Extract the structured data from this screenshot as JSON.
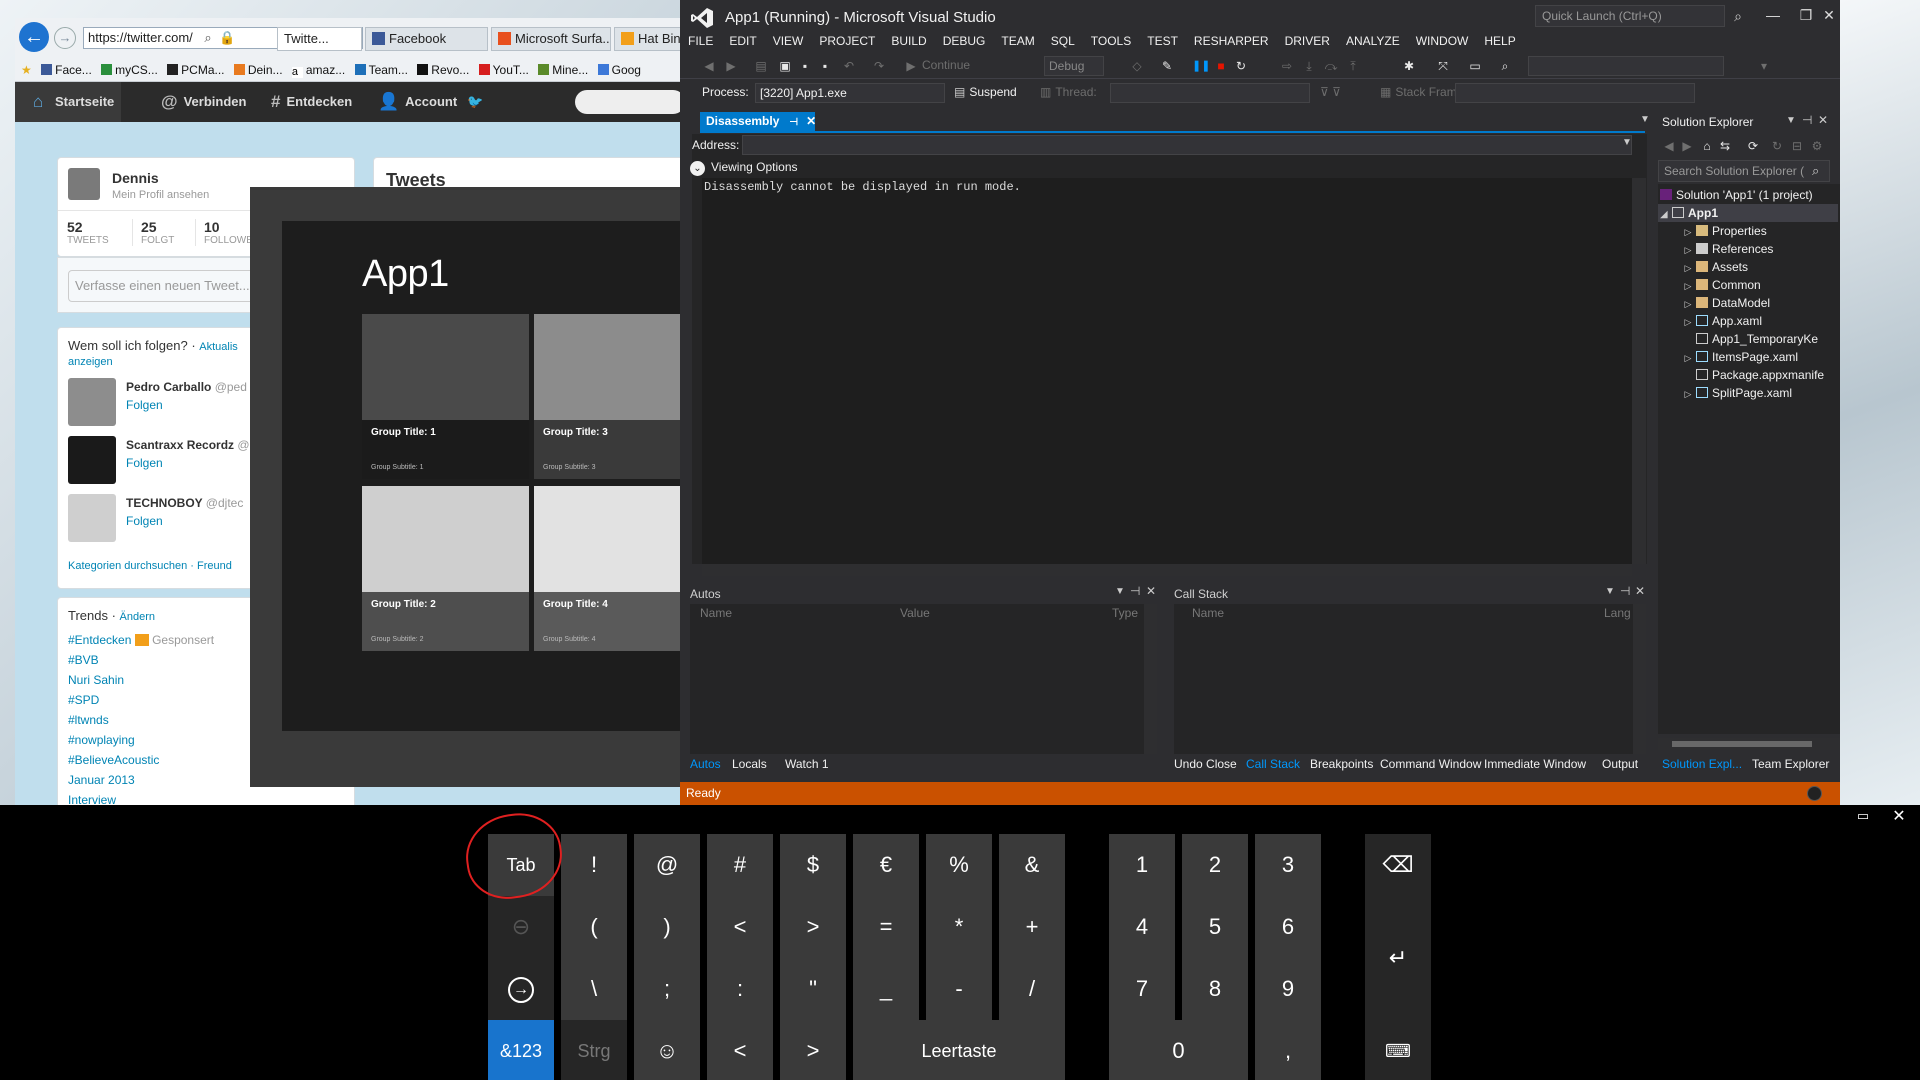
{
  "browser": {
    "address": "https://twitter.com/",
    "tabs": [
      "Twitte...",
      "Facebook",
      "Microsoft Surfa...",
      "Hat Bindin"
    ],
    "favorites": [
      "Face...",
      "myCS...",
      "PCMa...",
      "Dein...",
      "amaz...",
      "Team...",
      "Revo...",
      "YouT...",
      "Mine...",
      "Goog"
    ]
  },
  "twitter": {
    "nav": [
      "Startseite",
      "Verbinden",
      "Entdecken",
      "Account"
    ],
    "profile_name": "Dennis",
    "profile_link": "Mein Profil ansehen",
    "stats": [
      {
        "value": "52",
        "label": "TWEETS"
      },
      {
        "value": "25",
        "label": "FOLGT"
      },
      {
        "value": "10",
        "label": "FOLLOWER"
      }
    ],
    "compose_placeholder": "Verfasse einen neuen Tweet...",
    "tweets_heading": "Tweets",
    "who_to_follow": "Wem soll ich folgen?",
    "refresh": "Aktualis",
    "show_all": "anzeigen",
    "suggestions": [
      {
        "name": "Pedro Carballo",
        "handle": "@ped",
        "action": "Folgen"
      },
      {
        "name": "Scantraxx Recordz",
        "handle": "@",
        "action": "Folgen"
      },
      {
        "name": "TECHNOBOY",
        "handle": "@djtec",
        "action": "Folgen"
      }
    ],
    "browse_categories": "Kategorien durchsuchen",
    "friends_link": "Freund",
    "trends_heading": "Trends",
    "trends_change": "Ändern",
    "trends": [
      "#Entdecken",
      "#BVB",
      "Nuri Sahin",
      "#SPD",
      "#ltwnds",
      "#nowplaying",
      "#BelieveAcoustic",
      "Januar 2013",
      "Interview"
    ],
    "sponsored": "Gesponsert"
  },
  "app1": {
    "title": "App1",
    "tiles": [
      {
        "title": "Group Title: 1",
        "subtitle": "Group Subtitle: 1",
        "color": "#4a4a4a",
        "band": "#1b1b1b"
      },
      {
        "title": "Group Title: 3",
        "subtitle": "Group Subtitle: 3",
        "color": "#8c8c8c",
        "band": "#3a3a3a"
      },
      {
        "title": "Group Title: 2",
        "subtitle": "Group Subtitle: 2",
        "color": "#cfcfcf",
        "band": "#4e4e4e"
      },
      {
        "title": "Group Title: 4",
        "subtitle": "Group Subtitle: 4",
        "color": "#e2e2e2",
        "band": "#5a5a5a"
      }
    ]
  },
  "vs": {
    "title": "App1 (Running) - Microsoft Visual Studio",
    "quick_launch": "Quick Launch (Ctrl+Q)",
    "menu": [
      "FILE",
      "EDIT",
      "VIEW",
      "PROJECT",
      "BUILD",
      "DEBUG",
      "TEAM",
      "SQL",
      "TOOLS",
      "TEST",
      "RESHARPER",
      "DRIVER",
      "ANALYZE",
      "WINDOW",
      "HELP"
    ],
    "continue_label": "Continue",
    "config": "Debug",
    "process_label": "Process:",
    "process_value": "[3220] App1.exe",
    "suspend_label": "Suspend",
    "thread_label": "Thread:",
    "stack_frame_label": "Stack Frame:",
    "doc_tab": "Disassembly",
    "address_label": "Address:",
    "viewing_options": "Viewing Options",
    "disassembly_msg": "Disassembly cannot be displayed in run mode.",
    "autos": {
      "title": "Autos",
      "columns": [
        "Name",
        "Value",
        "Type"
      ]
    },
    "callstack": {
      "title": "Call Stack",
      "columns": [
        "Name",
        "Lang"
      ]
    },
    "bottom_left_tabs": [
      "Autos",
      "Locals",
      "Watch 1"
    ],
    "bottom_right_tabs": [
      "Undo Close",
      "Call Stack",
      "Breakpoints",
      "Command Window",
      "Immediate Window",
      "Output"
    ],
    "status": "Ready",
    "solution_explorer": {
      "title": "Solution Explorer",
      "search": "Search Solution Explorer (",
      "solution": "Solution 'App1' (1 project)",
      "project": "App1",
      "items": [
        "Properties",
        "References",
        "Assets",
        "Common",
        "DataModel",
        "App.xaml",
        "App1_TemporaryKe",
        "ItemsPage.xaml",
        "Package.appxmanife",
        "SplitPage.xaml"
      ],
      "tabs": [
        "Solution Expl...",
        "Team Explorer"
      ]
    },
    "accent": "#007acc",
    "status_color": "#ca5100"
  },
  "keyboard": {
    "row1": [
      "Tab",
      "!",
      "@",
      "#",
      "$",
      "€",
      "%",
      "&"
    ],
    "row2": [
      "(",
      ")",
      "<",
      ">",
      "=",
      "*",
      "+"
    ],
    "row3": [
      "\\",
      ";",
      ":",
      "\"",
      "_",
      "-",
      "/"
    ],
    "row4_keys": [
      "&123",
      "Strg",
      "☺",
      "<",
      ">",
      "Leertaste"
    ],
    "numpad": [
      "1",
      "2",
      "3",
      "4",
      "5",
      "6",
      "7",
      "8",
      "9",
      "0",
      ","
    ],
    "back_icon": "⌫",
    "enter_icon": "↵"
  }
}
